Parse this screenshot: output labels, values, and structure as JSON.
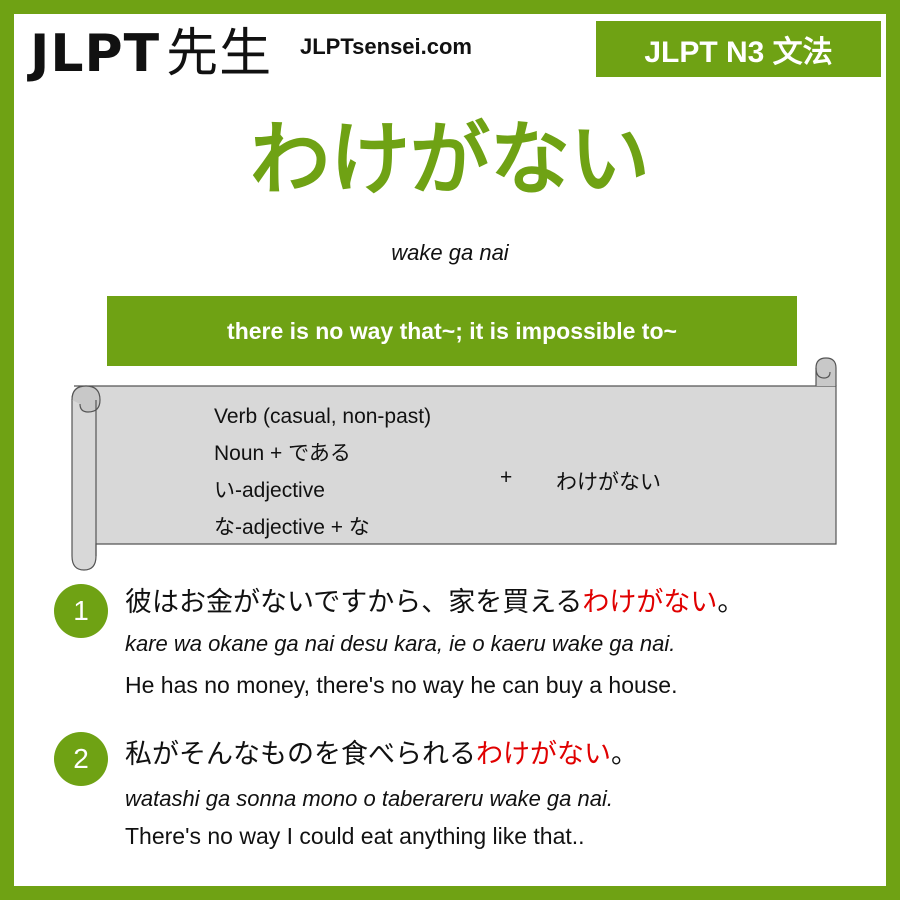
{
  "header": {
    "logo_jlpt": "JLPT",
    "logo_sensei": "先生",
    "site": "JLPTsensei.com",
    "badge": "JLPT N3 文法"
  },
  "grammar": {
    "title": "わけがない",
    "romaji": "wake ga nai",
    "meaning": "there is no way that~; it is impossible to~"
  },
  "formation": {
    "items": [
      "Verb (casual, non-past)",
      "Noun + である",
      "い-adjective",
      "な-adjective + な"
    ],
    "plus": "+",
    "target": "わけがない"
  },
  "examples": [
    {
      "number": "1",
      "jp_before": "彼はお金がないですから、家を買える",
      "jp_highlight": "わけがない",
      "jp_after": "。",
      "romaji": "kare wa okane ga nai desu kara, ie o kaeru wake ga nai.",
      "english": "He has no money, there's no way he can buy a house."
    },
    {
      "number": "2",
      "jp_before": "私がそんなものを食べられる",
      "jp_highlight": "わけがない",
      "jp_after": "。",
      "romaji": "watashi ga sonna mono o taberareru wake ga nai.",
      "english": "There's no way I could eat anything like that.."
    }
  ],
  "colors": {
    "brand_green": "#6fa214",
    "highlight_red": "#e00000",
    "scroll_gray": "#d8d8d8"
  }
}
